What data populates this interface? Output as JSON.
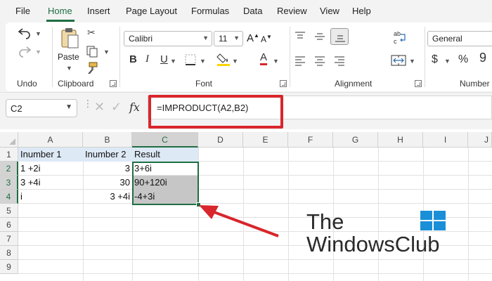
{
  "menu": {
    "items": [
      "File",
      "Home",
      "Insert",
      "Page Layout",
      "Formulas",
      "Data",
      "Review",
      "View",
      "Help"
    ],
    "active": "Home"
  },
  "ribbon": {
    "undo_group": "Undo",
    "clipboard": {
      "label": "Clipboard",
      "paste_label": "Paste"
    },
    "font": {
      "label": "Font",
      "font_name": "Calibri",
      "font_size": "11",
      "bold": "B",
      "italic": "I",
      "underline": "U",
      "font_color_letter": "A",
      "grow_font": "A",
      "shrink_font": "A"
    },
    "alignment": {
      "label": "Alignment"
    },
    "number": {
      "label": "Number",
      "format": "General",
      "currency": "$",
      "percent": "%"
    }
  },
  "formula_bar": {
    "name_box": "C2",
    "fx": "fx",
    "formula": "=IMPRODUCT(A2,B2)"
  },
  "sheet": {
    "columns": [
      "A",
      "B",
      "C",
      "D",
      "E",
      "F",
      "G",
      "H",
      "I",
      "J"
    ],
    "rows": [
      "1",
      "2",
      "3",
      "4",
      "5",
      "6",
      "7",
      "8",
      "9"
    ],
    "selected_column": "C",
    "selected_rows": [
      "2",
      "3",
      "4"
    ],
    "cells": {
      "A1": "Inumber 1",
      "B1": "Inumber 2",
      "C1": "Result",
      "A2": "1 +2i",
      "B2": "3",
      "C2": "3+6i",
      "A3": "3 +4i",
      "B3": "30",
      "C3": "90+120i",
      "A4": "i",
      "B4": "3 +4i",
      "C4": "-4+3i"
    }
  },
  "watermark": {
    "line1": "The",
    "line2": "WindowsClub"
  },
  "colors": {
    "accent": "#1f6e43",
    "callout": "#d8262c",
    "header_fill": "#dde9f5",
    "windows_blue": "#1a8fd8"
  }
}
